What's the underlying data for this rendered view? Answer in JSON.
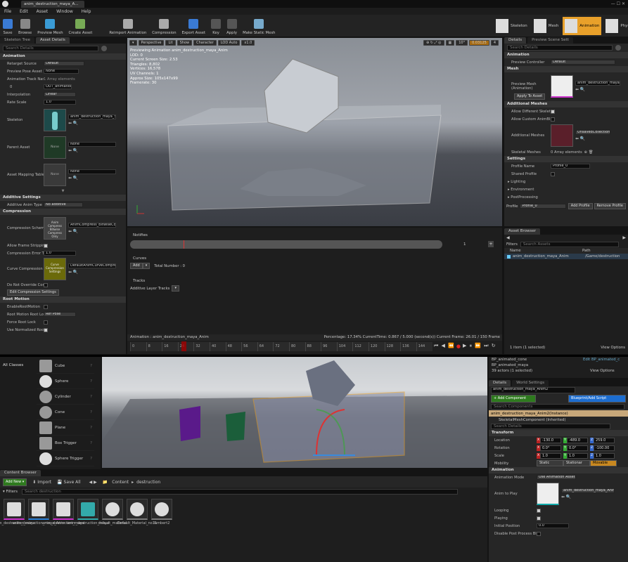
{
  "window": {
    "title": "anim_destruction_maya_A...",
    "menu": [
      "File",
      "Edit",
      "Asset",
      "Window",
      "Help"
    ]
  },
  "toolbar": {
    "buttons": [
      "Save",
      "Browse",
      "Preview Mesh",
      "Create Asset",
      "Reimport Animation",
      "Compression",
      "Export Asset",
      "Key",
      "Apply",
      "Make Static Mesh"
    ],
    "modes": [
      "Skeleton",
      "Mesh",
      "Animation",
      "Physics"
    ]
  },
  "skeleton_tree_tab": "Skeleton Tree",
  "asset_details_tab": "Asset Details",
  "search_details": "Search Details",
  "anim_section": "Animation",
  "anim_props": {
    "retarget_source": "Retarget Source",
    "retarget_value": "Default",
    "preview_pose": "Preview Pose Asset",
    "preview_pose_value": "None",
    "track_names": "Animation Track Nam",
    "track_value": "1 Array elements",
    "track_index": "0",
    "track_index_value": "OUT_animation",
    "interp": "Interpolation",
    "interp_value": "Linear",
    "rate": "Rate Scale",
    "rate_value": "1.0",
    "skeleton": "Skeleton",
    "skeleton_value": "anim_destruction_maya_Sk",
    "parent": "Parent Asset",
    "parent_value": "None",
    "thumb_none": "None",
    "mapping": "Asset Mapping Table",
    "mapping_value": "None"
  },
  "additive": {
    "section": "Additive Settings",
    "type_label": "Additive Anim Type",
    "type_value": "No additive"
  },
  "compression": {
    "section": "Compression",
    "scheme": "Compression Scheme",
    "scheme_value": "AnimCompress_BitwiseCo",
    "scheme_thumb": "Anim Compress Bitwise Compress Only",
    "allow_strip": "Allow Frame Strippin",
    "err": "Compression Error Th",
    "err_value": "1.0",
    "curve": "Curve Compression S",
    "curve_value": "DefaultAnimCurveCompre",
    "curve_thumb": "Curve Compression Settings",
    "no_override": "Do Not Override Com",
    "edit_btn": "Edit Compression Settings"
  },
  "root_motion": {
    "section": "Root Motion",
    "enable": "EnableRootMotion",
    "lock": "Root Motion Root Loc",
    "lock_value": "Ref Pose",
    "force": "Force Root Lock",
    "normalized": "Use Normalized Root"
  },
  "viewport": {
    "perspective": "Perspective",
    "lit": "Lit",
    "show": "Show",
    "character": "Character",
    "lod": "LOD Auto",
    "speed": "x1.0",
    "angle": "10°",
    "scale": "0.03125",
    "cam": "4",
    "info": [
      "Previewing Animation anim_destruction_maya_Anim",
      "LOD: 0",
      "Current Screen Size: 2.53",
      "Triangles: 8,802",
      "Vertices: 16,578",
      "UV Channels: 1",
      "Approx Size: 105x147x99",
      "Framerate: 30"
    ]
  },
  "timeline": {
    "notifies": "Notifies",
    "track_num": "1",
    "curves": "Curves",
    "add": "Add",
    "total": "Total Number : 0",
    "tracks": "Tracks",
    "additive_tracks": "Additive Layer Tracks",
    "status_anim": "Animation : anim_destruction_maya_Anim",
    "status_pct": "Percentage: 17.34% CurrentTime: 0.867 / 5.000 (second(s)) Current Frame: 26.01 / 150 Frame",
    "ticks": [
      "0",
      "8",
      "16",
      "24",
      "32",
      "40",
      "48",
      "56",
      "64",
      "72",
      "80",
      "88",
      "96",
      "104",
      "112",
      "120",
      "128",
      "136",
      "144"
    ]
  },
  "right_details": {
    "tab1": "Details",
    "tab2": "Preview Scene Sett",
    "search": "Search Details",
    "anim_sec": "Animation",
    "preview_ctrl": "Preview Controller",
    "preview_ctrl_value": "Default",
    "mesh_sec": "Mesh",
    "preview_mesh": "Preview Mesh (Animation)",
    "preview_mesh_value": "anim_destruction_maya",
    "apply_btn": "Apply To Asset",
    "add_sec": "Additional Meshes",
    "allow_diff": "Allow Different Skelet",
    "allow_custom": "Allow Custom AnimBl",
    "add_meshes": "Additional Meshes",
    "add_meshes_value": "UnsavedCollection",
    "skeletal_meshes": "Skeletal Meshes",
    "skeletal_value": "0 Array elements",
    "settings_sec": "Settings",
    "profile_name": "Profile Name",
    "profile_value": "Profile_0",
    "shared": "Shared Profile",
    "lighting": "Lighting",
    "environment": "Environment",
    "postproc": "PostProcessing",
    "profile_label": "Profile",
    "profile_dd": "Profile_0",
    "add_profile": "Add Profile",
    "remove_profile": "Remove Profile"
  },
  "asset_browser": {
    "tab": "Asset Browser",
    "search": "Search Assets",
    "filters": "Filters",
    "col_name": "Name",
    "col_path": "Path",
    "item_name": "anim_destruction_maya_Anim",
    "item_path": "/Game/destruction",
    "selected": "1 item (1 selected)",
    "view": "View Options"
  },
  "place": {
    "category": "All Classes",
    "items": [
      "Cube",
      "Sphere",
      "Cylinder",
      "Cone",
      "Plane",
      "Box Trigger",
      "Sphere Trigger"
    ]
  },
  "outliner": {
    "item1": "BP_animated_cone",
    "item1_link": "Edit BP_animated_c",
    "item2": "BP_animated_maya",
    "count": "39 actors (1 selected)",
    "view": "View Options"
  },
  "level_details": {
    "tab1": "Details",
    "tab2": "World Settings",
    "name": "anim_destruction_maya_Anim2",
    "add_comp": "+ Add Component",
    "blueprint": "Blueprint/Add Script",
    "search_comp": "Search Components",
    "instance": "anim_destruction_maya_Anim2(Instance)",
    "skel_comp": "SkeletalMeshComponent (Inherited)",
    "search": "Search Details",
    "transform": "Transform",
    "location": "Location",
    "rotation": "Rotation",
    "scale": "Scale",
    "loc": [
      "-130.0",
      "-489.0",
      "259.0"
    ],
    "rot": [
      "0.0°",
      "0.0°",
      "-100.00"
    ],
    "scl": [
      "1.0",
      "1.0",
      "1.0"
    ],
    "mobility": "Mobility",
    "mob": [
      "Static",
      "Stationar",
      "Movable"
    ],
    "anim_sec": "Animation",
    "anim_mode": "Animation Mode",
    "anim_mode_value": "Use Animation Asset",
    "anim_to_play": "Anim to Play",
    "anim_to_play_value": "anim_destruction_maya_Anim",
    "looping": "Looping",
    "playing": "Playing",
    "init_pos": "Initial Position",
    "init_pos_value": "0.0",
    "disable_pp": "Disable Post Process Blu"
  },
  "content_browser": {
    "tab": "Content Browser",
    "add_new": "Add New",
    "import": "Import",
    "save_all": "Save All",
    "path1": "Content",
    "path2": "destruction",
    "filters": "Filters",
    "search": "Search destruction",
    "assets": [
      {
        "name": "anim_destruction_maya"
      },
      {
        "name": "anim_destruction_maya_Anim"
      },
      {
        "name": "anim_destruction_maya"
      },
      {
        "name": "anim_destruction_maya"
      },
      {
        "name": "default_material"
      },
      {
        "name": "Default_Material_no11"
      },
      {
        "name": "lambert2"
      }
    ]
  },
  "colors": {
    "accent": "#e8a02a",
    "green": "#5cb82e",
    "blue": "#1c6dd0",
    "orange_sel": "#c88820"
  }
}
